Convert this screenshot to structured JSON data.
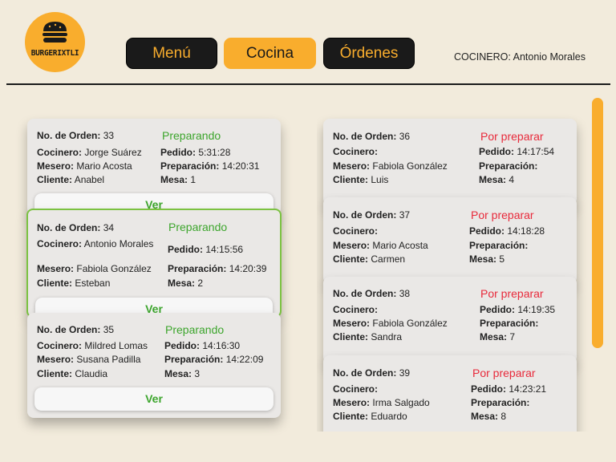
{
  "brand": {
    "logo_text": "BURGERIXTLI"
  },
  "nav": {
    "menu": "Menú",
    "kitchen": "Cocina",
    "orders": "Órdenes"
  },
  "header": {
    "cook_label": "COCINERO:",
    "cook_name": "Antonio Morales"
  },
  "labels": {
    "order_no": "No. de Orden:",
    "cook": "Cocinero:",
    "waiter": "Mesero:",
    "client": "Cliente:",
    "ordered": "Pedido:",
    "prep": "Preparación:",
    "table": "Mesa:",
    "view": "Ver"
  },
  "orders_left": [
    {
      "no": "33",
      "status": "Preparando",
      "cook": "Jorge Suárez",
      "waiter": "Mario Acosta",
      "client": "Anabel",
      "ordered": "5:31:28",
      "prep": "14:20:31",
      "table": "1"
    },
    {
      "no": "34",
      "status": "Preparando",
      "cook": "Antonio Morales",
      "waiter": "Fabiola González",
      "client": "Esteban",
      "ordered": "14:15:56",
      "prep": "14:20:39",
      "table": "2"
    },
    {
      "no": "35",
      "status": "Preparando",
      "cook": "Mildred Lomas",
      "waiter": "Susana Padilla",
      "client": "Claudia",
      "ordered": "14:16:30",
      "prep": "14:22:09",
      "table": "3"
    }
  ],
  "orders_right": [
    {
      "no": "36",
      "status": "Por preparar",
      "cook": "",
      "waiter": "Fabiola González",
      "client": "Luis",
      "ordered": "14:17:54",
      "prep": "",
      "table": "4"
    },
    {
      "no": "37",
      "status": "Por preparar",
      "cook": "",
      "waiter": "Mario Acosta",
      "client": "Carmen",
      "ordered": "14:18:28",
      "prep": "",
      "table": "5"
    },
    {
      "no": "38",
      "status": "Por preparar",
      "cook": "",
      "waiter": "Fabiola González",
      "client": "Sandra",
      "ordered": "14:19:35",
      "prep": "",
      "table": "7"
    },
    {
      "no": "39",
      "status": "Por preparar",
      "cook": "",
      "waiter": "Irma Salgado",
      "client": "Eduardo",
      "ordered": "14:23:21",
      "prep": "",
      "table": "8"
    }
  ],
  "colors": {
    "accent": "#f9ad2d",
    "dark": "#1a1a1a",
    "preparing": "#3ca52c",
    "pending": "#e8293a",
    "background": "#f2ebdc"
  }
}
